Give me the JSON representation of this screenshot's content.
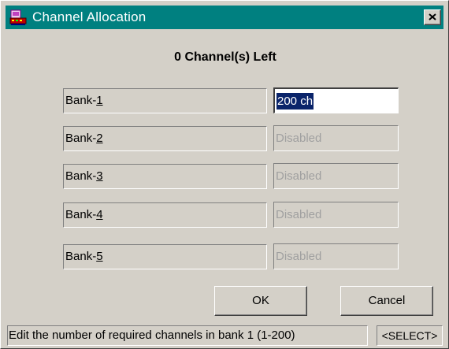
{
  "window": {
    "title": "Channel Allocation",
    "icon": "app-icon",
    "close_icon": "close-icon"
  },
  "heading": "0 Channel(s) Left",
  "banks": [
    {
      "prefix": "Bank-",
      "number": "1",
      "value": "200 ch",
      "enabled": true
    },
    {
      "prefix": "Bank-",
      "number": "2",
      "value": "Disabled",
      "enabled": false
    },
    {
      "prefix": "Bank-",
      "number": "3",
      "value": "Disabled",
      "enabled": false
    },
    {
      "prefix": "Bank-",
      "number": "4",
      "value": "Disabled",
      "enabled": false
    },
    {
      "prefix": "Bank-",
      "number": "5",
      "value": "Disabled",
      "enabled": false
    }
  ],
  "buttons": {
    "ok": "OK",
    "cancel": "Cancel"
  },
  "status": {
    "message": "Edit the number of required channels in bank 1 (1-200)",
    "mode": "<SELECT>"
  },
  "colors": {
    "titlebar": "#008080",
    "dialog_bg": "#d4d0c8",
    "selection": "#0a246a"
  }
}
